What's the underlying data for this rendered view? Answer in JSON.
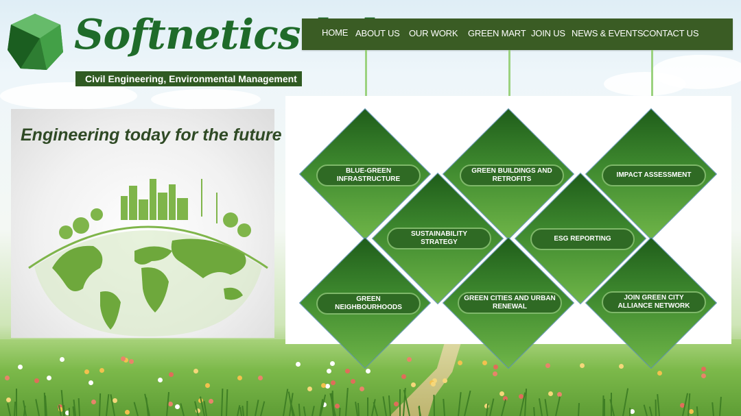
{
  "brand": {
    "name": "Softnetics ltd",
    "tagline": "Civil Engineering, Environmental Management"
  },
  "nav": {
    "home": "HOME",
    "about": "ABOUT US",
    "work": "OUR WORK",
    "mart": "GREEN MART",
    "join": "JOIN US",
    "news": "NEWS & EVENTS",
    "contact": "CONTACT US"
  },
  "hero": {
    "title": "Engineering today for the future"
  },
  "services": {
    "s1": "BLUE-GREEN INFRASTRUCTURE",
    "s2": "GREEN BUILDINGS AND RETROFITS",
    "s3": "IMPACT ASSESSMENT",
    "s4": "SUSTAINABILITY STRATEGY",
    "s5": "ESG REPORTING",
    "s6": "GREEN NEIGHBOURHOODS",
    "s7": "GREEN CITIES AND URBAN RENEWAL",
    "s8": "JOIN GREEN CITY ALLIANCE NETWORK"
  },
  "colors": {
    "nav_bg": "#3a5c24",
    "brand_green": "#1f6b2a",
    "diamond_dark": "#1f5d1a",
    "diamond_light": "#6fb548",
    "pill_bg": "#2f6a24"
  }
}
